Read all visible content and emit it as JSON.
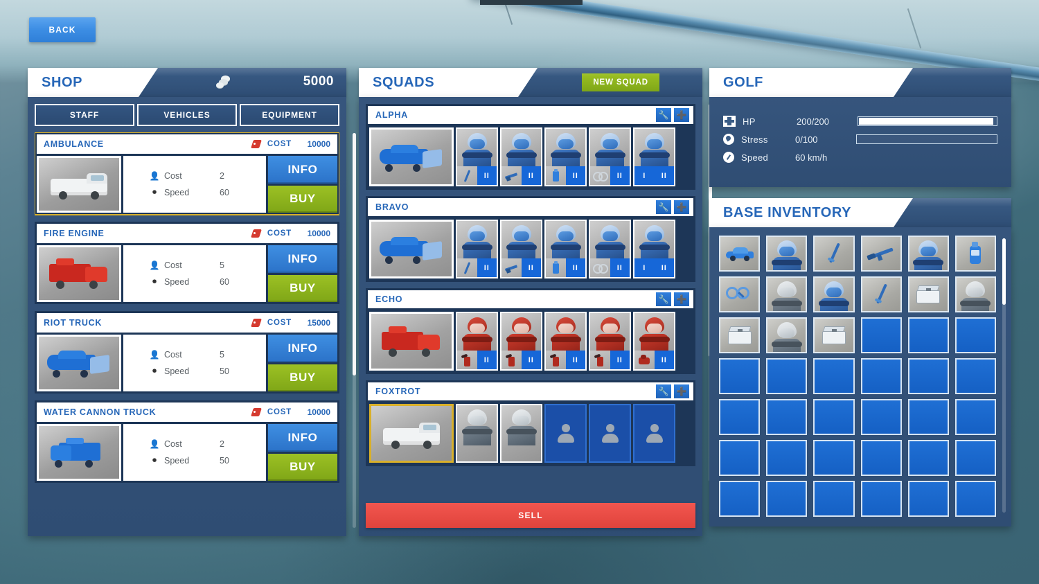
{
  "nav": {
    "back_label": "BACK"
  },
  "shop": {
    "title": "SHOP",
    "money": "5000",
    "money_icon": "coins-icon",
    "tabs": [
      {
        "label": "STAFF",
        "active": false
      },
      {
        "label": "VEHICLES",
        "active": true
      },
      {
        "label": "EQUIPMENT",
        "active": false
      }
    ],
    "cost_label": "COST",
    "stat_labels": {
      "cost": "Cost",
      "speed": "Speed"
    },
    "items": [
      {
        "name": "AMBULANCE",
        "price": "10000",
        "crew_cost": "2",
        "speed": "60",
        "info_label": "INFO",
        "buy_label": "BUY",
        "selected": true,
        "vehicle": "ambulance"
      },
      {
        "name": "FIRE ENGINE",
        "price": "10000",
        "crew_cost": "5",
        "speed": "60",
        "info_label": "INFO",
        "buy_label": "BUY",
        "selected": false,
        "vehicle": "fire"
      },
      {
        "name": "RIOT TRUCK",
        "price": "15000",
        "crew_cost": "5",
        "speed": "50",
        "info_label": "INFO",
        "buy_label": "BUY",
        "selected": false,
        "vehicle": "riot"
      },
      {
        "name": "WATER CANNON TRUCK",
        "price": "10000",
        "crew_cost": "2",
        "speed": "50",
        "info_label": "INFO",
        "buy_label": "BUY",
        "selected": false,
        "vehicle": "water"
      }
    ]
  },
  "squads": {
    "title": "SQUADS",
    "new_squad_label": "NEW SQUAD",
    "sell_label": "SELL",
    "row_buttons": [
      "wrench-icon",
      "plus-icon"
    ],
    "list": [
      {
        "name": "ALPHA",
        "vehicle": "riot",
        "vehicle_selected": false,
        "members": [
          {
            "type": "cop-blue",
            "slots": [
              "baton-icon",
              "II"
            ]
          },
          {
            "type": "cop-blue",
            "slots": [
              "rifle-icon",
              "II"
            ]
          },
          {
            "type": "cop-blue",
            "slots": [
              "spray-icon",
              "II"
            ]
          },
          {
            "type": "cop-blue",
            "slots": [
              "cuffs-icon",
              "II"
            ]
          },
          {
            "type": "cop-blue",
            "slots": [
              "I",
              "II"
            ]
          }
        ]
      },
      {
        "name": "BRAVO",
        "vehicle": "riot",
        "vehicle_selected": false,
        "members": [
          {
            "type": "cop-blue",
            "slots": [
              "baton-icon",
              "II"
            ]
          },
          {
            "type": "cop-blue",
            "slots": [
              "rifle-icon",
              "II"
            ]
          },
          {
            "type": "cop-blue",
            "slots": [
              "spray-icon",
              "II"
            ]
          },
          {
            "type": "cop-blue",
            "slots": [
              "cuffs-icon",
              "II"
            ]
          },
          {
            "type": "cop-blue",
            "slots": [
              "I",
              "II"
            ]
          }
        ]
      },
      {
        "name": "ECHO",
        "vehicle": "fire",
        "vehicle_selected": false,
        "members": [
          {
            "type": "fireman-red",
            "slots": [
              "extinguisher-icon",
              "II"
            ]
          },
          {
            "type": "fireman-red",
            "slots": [
              "extinguisher-icon",
              "II"
            ]
          },
          {
            "type": "fireman-red",
            "slots": [
              "extinguisher-icon",
              "II"
            ]
          },
          {
            "type": "fireman-red",
            "slots": [
              "extinguisher-icon",
              "II"
            ]
          },
          {
            "type": "fireman-red",
            "slots": [
              "suit-icon",
              "II"
            ]
          }
        ]
      },
      {
        "name": "FOXTROT",
        "vehicle": "ambulance",
        "vehicle_selected": true,
        "members": [
          {
            "type": "medic-grey",
            "slots": []
          },
          {
            "type": "medic-grey",
            "slots": []
          },
          {
            "type": "empty",
            "slots": []
          },
          {
            "type": "empty",
            "slots": []
          },
          {
            "type": "empty",
            "slots": []
          }
        ]
      }
    ]
  },
  "golf": {
    "title": "GOLF",
    "stats": [
      {
        "icon": "health-cross-icon",
        "label": "HP",
        "value": "200/200",
        "bar": 100
      },
      {
        "icon": "stress-drop-icon",
        "label": "Stress",
        "value": "0/100",
        "bar": 0
      },
      {
        "icon": "speedometer-icon",
        "label": "Speed",
        "value": "60 km/h",
        "bar": -1
      }
    ]
  },
  "inventory": {
    "title": "BASE INVENTORY",
    "cells": [
      "car-icon",
      "cop-blue-icon",
      "baton-icon",
      "rifle-icon",
      "cop-blue-icon",
      "spray-icon",
      "cuffs-icon",
      "medic-grey-icon",
      "cop-blue-icon",
      "baton-icon",
      "medkit-icon",
      "medic-grey-icon",
      "medkit-icon",
      "medic-grey-icon",
      "medkit-icon",
      "empty",
      "empty",
      "empty",
      "empty",
      "empty",
      "empty",
      "empty",
      "empty",
      "empty",
      "empty",
      "empty",
      "empty",
      "empty",
      "empty",
      "empty",
      "empty",
      "empty",
      "empty",
      "empty",
      "empty",
      "empty",
      "empty",
      "empty",
      "empty",
      "empty",
      "empty",
      "empty"
    ]
  },
  "colors": {
    "accent_blue": "#2767b8",
    "buy_green": "#9cc124",
    "info_blue": "#3f8fe2",
    "sell_red": "#f2564f",
    "select_gold": "#d9b02a",
    "panel_dark": "#2f4d73"
  }
}
